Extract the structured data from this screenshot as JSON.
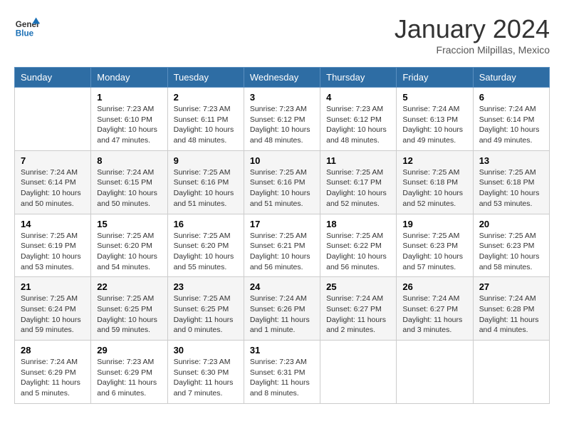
{
  "logo": {
    "line1": "General",
    "line2": "Blue"
  },
  "title": "January 2024",
  "subtitle": "Fraccion Milpillas, Mexico",
  "days_of_week": [
    "Sunday",
    "Monday",
    "Tuesday",
    "Wednesday",
    "Thursday",
    "Friday",
    "Saturday"
  ],
  "weeks": [
    [
      {
        "num": "",
        "info": ""
      },
      {
        "num": "1",
        "info": "Sunrise: 7:23 AM\nSunset: 6:10 PM\nDaylight: 10 hours\nand 47 minutes."
      },
      {
        "num": "2",
        "info": "Sunrise: 7:23 AM\nSunset: 6:11 PM\nDaylight: 10 hours\nand 48 minutes."
      },
      {
        "num": "3",
        "info": "Sunrise: 7:23 AM\nSunset: 6:12 PM\nDaylight: 10 hours\nand 48 minutes."
      },
      {
        "num": "4",
        "info": "Sunrise: 7:23 AM\nSunset: 6:12 PM\nDaylight: 10 hours\nand 48 minutes."
      },
      {
        "num": "5",
        "info": "Sunrise: 7:24 AM\nSunset: 6:13 PM\nDaylight: 10 hours\nand 49 minutes."
      },
      {
        "num": "6",
        "info": "Sunrise: 7:24 AM\nSunset: 6:14 PM\nDaylight: 10 hours\nand 49 minutes."
      }
    ],
    [
      {
        "num": "7",
        "info": "Sunrise: 7:24 AM\nSunset: 6:14 PM\nDaylight: 10 hours\nand 50 minutes."
      },
      {
        "num": "8",
        "info": "Sunrise: 7:24 AM\nSunset: 6:15 PM\nDaylight: 10 hours\nand 50 minutes."
      },
      {
        "num": "9",
        "info": "Sunrise: 7:25 AM\nSunset: 6:16 PM\nDaylight: 10 hours\nand 51 minutes."
      },
      {
        "num": "10",
        "info": "Sunrise: 7:25 AM\nSunset: 6:16 PM\nDaylight: 10 hours\nand 51 minutes."
      },
      {
        "num": "11",
        "info": "Sunrise: 7:25 AM\nSunset: 6:17 PM\nDaylight: 10 hours\nand 52 minutes."
      },
      {
        "num": "12",
        "info": "Sunrise: 7:25 AM\nSunset: 6:18 PM\nDaylight: 10 hours\nand 52 minutes."
      },
      {
        "num": "13",
        "info": "Sunrise: 7:25 AM\nSunset: 6:18 PM\nDaylight: 10 hours\nand 53 minutes."
      }
    ],
    [
      {
        "num": "14",
        "info": "Sunrise: 7:25 AM\nSunset: 6:19 PM\nDaylight: 10 hours\nand 53 minutes."
      },
      {
        "num": "15",
        "info": "Sunrise: 7:25 AM\nSunset: 6:20 PM\nDaylight: 10 hours\nand 54 minutes."
      },
      {
        "num": "16",
        "info": "Sunrise: 7:25 AM\nSunset: 6:20 PM\nDaylight: 10 hours\nand 55 minutes."
      },
      {
        "num": "17",
        "info": "Sunrise: 7:25 AM\nSunset: 6:21 PM\nDaylight: 10 hours\nand 56 minutes."
      },
      {
        "num": "18",
        "info": "Sunrise: 7:25 AM\nSunset: 6:22 PM\nDaylight: 10 hours\nand 56 minutes."
      },
      {
        "num": "19",
        "info": "Sunrise: 7:25 AM\nSunset: 6:23 PM\nDaylight: 10 hours\nand 57 minutes."
      },
      {
        "num": "20",
        "info": "Sunrise: 7:25 AM\nSunset: 6:23 PM\nDaylight: 10 hours\nand 58 minutes."
      }
    ],
    [
      {
        "num": "21",
        "info": "Sunrise: 7:25 AM\nSunset: 6:24 PM\nDaylight: 10 hours\nand 59 minutes."
      },
      {
        "num": "22",
        "info": "Sunrise: 7:25 AM\nSunset: 6:25 PM\nDaylight: 10 hours\nand 59 minutes."
      },
      {
        "num": "23",
        "info": "Sunrise: 7:25 AM\nSunset: 6:25 PM\nDaylight: 11 hours\nand 0 minutes."
      },
      {
        "num": "24",
        "info": "Sunrise: 7:24 AM\nSunset: 6:26 PM\nDaylight: 11 hours\nand 1 minute."
      },
      {
        "num": "25",
        "info": "Sunrise: 7:24 AM\nSunset: 6:27 PM\nDaylight: 11 hours\nand 2 minutes."
      },
      {
        "num": "26",
        "info": "Sunrise: 7:24 AM\nSunset: 6:27 PM\nDaylight: 11 hours\nand 3 minutes."
      },
      {
        "num": "27",
        "info": "Sunrise: 7:24 AM\nSunset: 6:28 PM\nDaylight: 11 hours\nand 4 minutes."
      }
    ],
    [
      {
        "num": "28",
        "info": "Sunrise: 7:24 AM\nSunset: 6:29 PM\nDaylight: 11 hours\nand 5 minutes."
      },
      {
        "num": "29",
        "info": "Sunrise: 7:23 AM\nSunset: 6:29 PM\nDaylight: 11 hours\nand 6 minutes."
      },
      {
        "num": "30",
        "info": "Sunrise: 7:23 AM\nSunset: 6:30 PM\nDaylight: 11 hours\nand 7 minutes."
      },
      {
        "num": "31",
        "info": "Sunrise: 7:23 AM\nSunset: 6:31 PM\nDaylight: 11 hours\nand 8 minutes."
      },
      {
        "num": "",
        "info": ""
      },
      {
        "num": "",
        "info": ""
      },
      {
        "num": "",
        "info": ""
      }
    ]
  ]
}
